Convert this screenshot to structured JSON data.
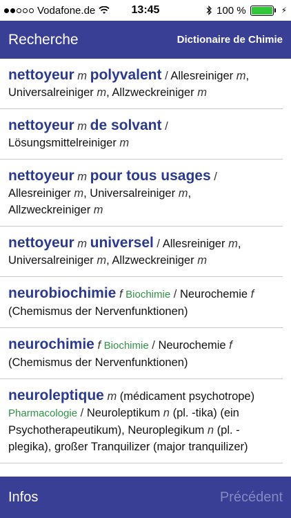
{
  "status_bar": {
    "carrier": "Vodafone.de",
    "time": "13:45",
    "battery": "100 %",
    "battery_level": 1.0,
    "signal_bars_filled": 2,
    "signal_bars_total": 5
  },
  "navbar": {
    "back_label": "Recherche",
    "title": "Dictionaire de Chimie"
  },
  "entries": [
    {
      "term": "nettoyeur",
      "gender": "m",
      "term2": "polyvalent",
      "sep": " / ",
      "rest1": "Allesreiniger ",
      "g1": "m",
      "rest2": ", Universalreiniger ",
      "g2": "m",
      "rest3": ", Allzweckreiniger ",
      "g3": "m"
    },
    {
      "term": "nettoyeur",
      "gender": "m",
      "term2": "de solvant",
      "sep": " / ",
      "rest1": "Lösungsmittelreiniger ",
      "g1": "m"
    },
    {
      "term": "nettoyeur",
      "gender": "m",
      "term2": "pour tous usages",
      "sep": " / ",
      "rest1": "Allesreiniger ",
      "g1": "m",
      "rest2": ", Universalreiniger ",
      "g2": "m",
      "rest3": ", Allzweckreiniger ",
      "g3": "m"
    },
    {
      "term": "nettoyeur",
      "gender": "m",
      "term2": "universel",
      "sep": " / ",
      "rest1": "Allesreiniger ",
      "g1": "m",
      "rest2": ", Universalreiniger ",
      "g2": "m",
      "rest3": ", Allzweckreiniger ",
      "g3": "m"
    },
    {
      "term": "neurobiochimie",
      "gender": "f",
      "domain": "Biochimie",
      "sep": " / ",
      "rest1": "Neurochemie ",
      "g1": "f",
      "rest2": " (Chemismus der Nervenfunktionen)"
    },
    {
      "term": "neurochimie",
      "gender": "f",
      "domain": "Biochimie",
      "sep": " / ",
      "rest1": "Neurochemie ",
      "g1": "f",
      "rest2": " (Chemismus der Nervenfunktionen)"
    },
    {
      "term": "neuroleptique",
      "gender": "m",
      "note": " (médicament psychotrope) ",
      "domain": "Pharmacologie",
      "sep": " / ",
      "rest1": "Neuroleptikum ",
      "g1": "n",
      "rest2": " (pl. -tika) (ein Psychotherapeutikum), Neuroplegikum ",
      "g2": "n",
      "rest3": " (pl. -plegika), großer Tranquilizer (major tranquilizer)"
    }
  ],
  "toolbar": {
    "info_label": "Infos",
    "prev_label": "Précédent"
  },
  "colors": {
    "bar": "#3a3f96",
    "term": "#2b3a8c",
    "domain": "#2e9444",
    "disabled": "#8589c0"
  }
}
